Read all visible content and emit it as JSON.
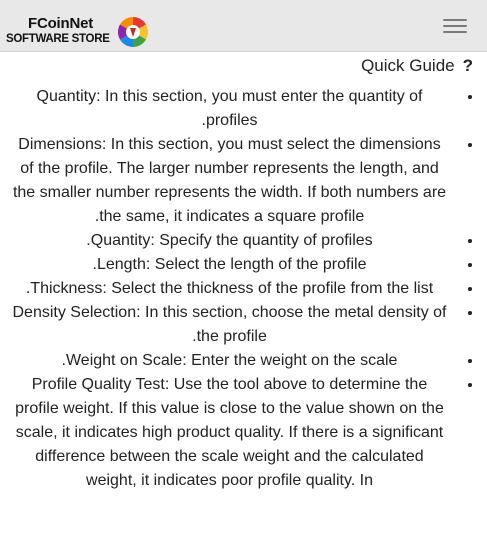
{
  "navbar": {
    "brand_name": "FCoinNet",
    "brand_sub": "SOFTWARE STORE",
    "logo_icon": "fcoinnet-logo-icon",
    "menu_icon": "hamburger-menu-icon"
  },
  "guide": {
    "title": "Quick Guide",
    "help_glyph": "?",
    "items": [
      "Quantity: In this section, you must enter the quantity of profiles.",
      "Dimensions: In this section, you must select the dimensions of the profile. The larger number represents the length, and the smaller number represents the width. If both numbers are the same, it indicates a square profile.",
      "Quantity: Specify the quantity of profiles.",
      "Length: Select the length of the profile.",
      "Thickness: Select the thickness of the profile from the list.",
      "Density Selection: In this section, choose the metal density of the profile.",
      "Weight on Scale: Enter the weight on the scale.",
      "Profile Quality Test: Use the tool above to determine the profile weight. If this value is close to the value shown on the scale, it indicates high product quality. If there is a significant difference between the scale weight and the calculated weight, it indicates poor profile quality. In"
    ]
  },
  "colors": {
    "navbar_bg": "#e8e8e8",
    "text": "#222222"
  }
}
